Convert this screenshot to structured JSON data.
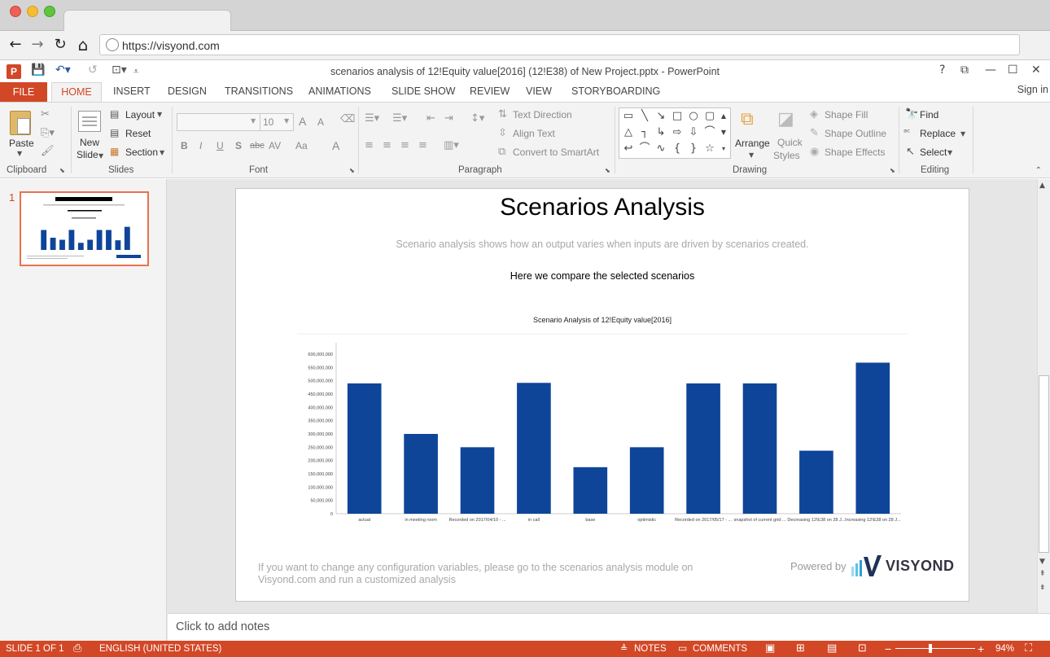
{
  "browser": {
    "url": "https://visyond.com",
    "back_icon": "←",
    "forward_icon": "→",
    "reload_icon": "↻",
    "home_icon": "⌂"
  },
  "app": {
    "logo_letter": "P",
    "title": "scenarios analysis of 12!Equity value[2016] (12!E38) of New Project.pptx - PowerPoint",
    "help": "?",
    "restore": "⧉",
    "minimize": "—",
    "maximize": "☐",
    "close": "✕"
  },
  "tabs": {
    "file": "FILE",
    "items": [
      "HOME",
      "INSERT",
      "DESIGN",
      "TRANSITIONS",
      "ANIMATIONS",
      "SLIDE SHOW",
      "REVIEW",
      "VIEW",
      "STORYBOARDING"
    ],
    "sign_in": "Sign in"
  },
  "ribbon": {
    "clipboard": {
      "paste": "Paste",
      "label": "Clipboard"
    },
    "slides": {
      "new_slide_1": "New",
      "new_slide_2": "Slide",
      "layout": "Layout",
      "reset": "Reset",
      "section": "Section",
      "label": "Slides"
    },
    "font": {
      "size": "10",
      "label": "Font",
      "bold": "B",
      "italic": "I",
      "underline": "U",
      "shadow": "S",
      "strike": "abc",
      "spacing": "AV",
      "case": "Aa",
      "color": "A",
      "grow": "A",
      "shrink": "A"
    },
    "paragraph": {
      "text_direction": "Text Direction",
      "align_text": "Align Text",
      "convert_smartart": "Convert to SmartArt",
      "label": "Paragraph"
    },
    "drawing": {
      "arrange": "Arrange",
      "quick_styles_1": "Quick",
      "quick_styles_2": "Styles",
      "shape_fill": "Shape Fill",
      "shape_outline": "Shape Outline",
      "shape_effects": "Shape Effects",
      "label": "Drawing"
    },
    "editing": {
      "find": "Find",
      "replace": "Replace",
      "select": "Select",
      "label": "Editing"
    }
  },
  "thumbnail": {
    "number": "1"
  },
  "slide": {
    "title": "Scenarios Analysis",
    "subtitle": "Scenario analysis shows how an output varies when inputs are driven by scenarios created.",
    "compare": "Here we compare the selected scenarios",
    "footer": "If you want to change any configuration variables, please go to the scenarios analysis module on Visyond.com and run a customized analysis",
    "powered_by": "Powered by",
    "brand": "VISYOND"
  },
  "chart_data": {
    "type": "bar",
    "title": "Scenario Analysis of 12!Equity value[2016]",
    "categories": [
      "actual",
      "in meeting room",
      "Recorded on 2017/04/10 - ...",
      "in call",
      "base",
      "optimistic",
      "Recorded on 2017/05/17 - ...",
      "snapshot of current grid ...",
      "Decreasing 12!E38 on 28 J...",
      "Increasing 12!E38 on 28 J..."
    ],
    "values": [
      490000000,
      300000000,
      250000000,
      492000000,
      175000000,
      250000000,
      490000000,
      490000000,
      237000000,
      568000000
    ],
    "ylim": [
      0,
      600000000
    ],
    "yticks": [
      "0",
      "50,000,000",
      "100,000,000",
      "150,000,000",
      "200,000,000",
      "250,000,000",
      "300,000,000",
      "350,000,000",
      "400,000,000",
      "450,000,000",
      "500,000,000",
      "550,000,000",
      "600,000,000"
    ],
    "bar_color": "#0e4599",
    "grid": false
  },
  "notes": {
    "placeholder": "Click to add notes"
  },
  "status": {
    "slide": "SLIDE 1 OF 1",
    "language": "ENGLISH (UNITED STATES)",
    "notes": "NOTES",
    "comments": "COMMENTS",
    "zoom_minus": "−",
    "zoom_plus": "+",
    "zoom": "94%"
  },
  "colors": {
    "accent": "#d24726",
    "bar": "#0e4599"
  }
}
